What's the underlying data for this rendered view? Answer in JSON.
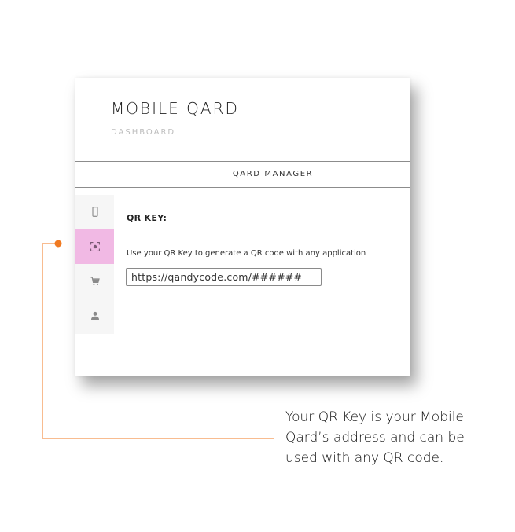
{
  "app": {
    "title": "MOBILE QARD",
    "subtitle": "DASHBOARD"
  },
  "manager": {
    "label": "QARD MANAGER"
  },
  "sidebar": {
    "items": [
      {
        "icon": "mobile-phone-icon",
        "active": false
      },
      {
        "icon": "qr-scan-icon",
        "active": true
      },
      {
        "icon": "shopping-cart-icon",
        "active": false
      },
      {
        "icon": "person-icon",
        "active": false
      }
    ]
  },
  "content": {
    "heading": "QR KEY:",
    "description": "Use your QR Key to generate a QR code with any application",
    "qr_key_value": "https://qandycode.com/######"
  },
  "callout": {
    "text": "Your QR Key is your Mobile Qard’s address and can be used with any QR code."
  },
  "colors": {
    "active_tab": "#f1b9e4",
    "callout_accent": "#f07a21",
    "sidebar_bg": "#f6f6f6"
  }
}
